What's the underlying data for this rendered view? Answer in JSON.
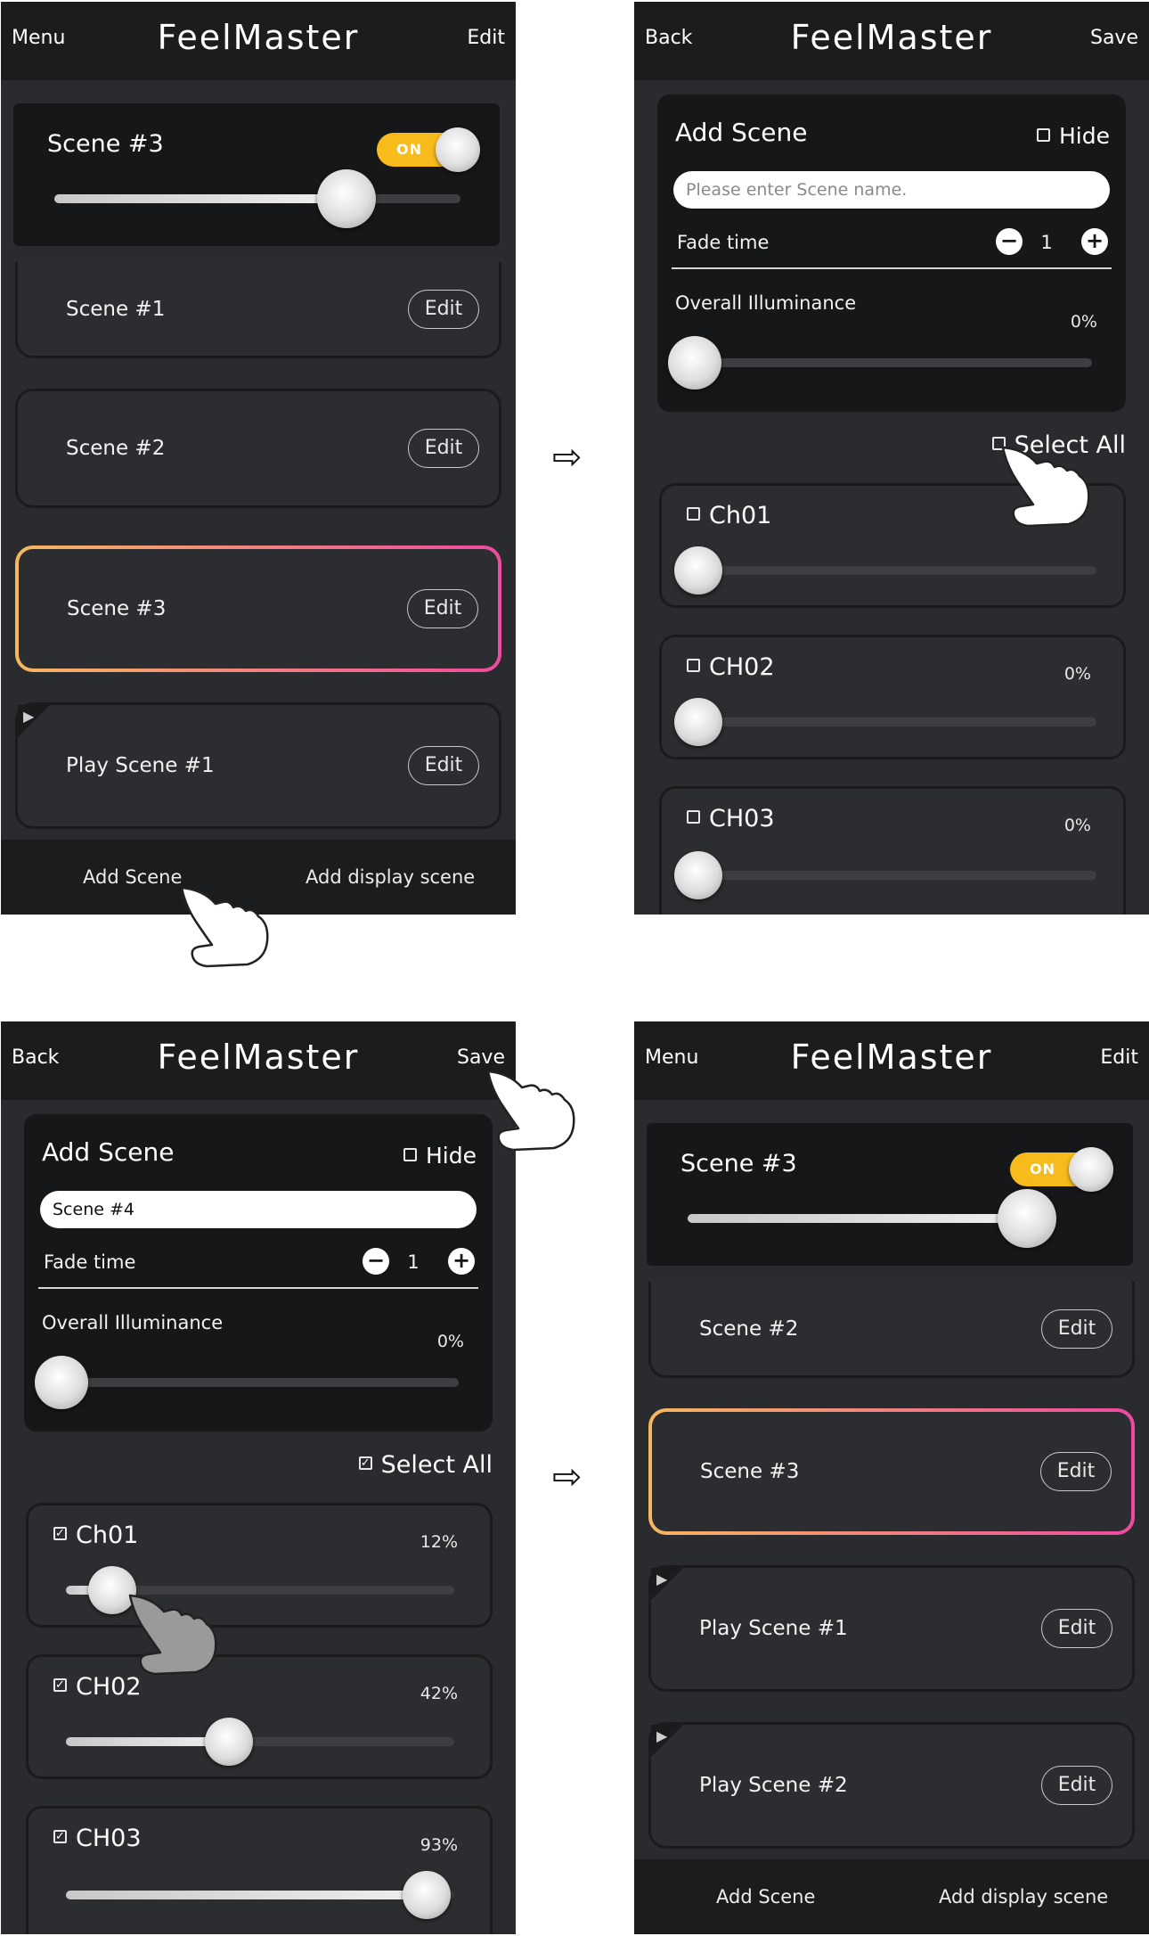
{
  "logo": "FeelMaster",
  "arrow_glyph": "⇨",
  "checkmark": "✓",
  "icons": [
    "hand-pointer-icon",
    "play-triangle-icon",
    "minus-icon",
    "plus-icon",
    "checkbox-icon"
  ],
  "colors": {
    "toggle_on": "#f7bb1b",
    "selected_gradient_start": "#f6b85f",
    "selected_gradient_end": "#ee4aa0",
    "screen_bg": "#2a2b2e",
    "bar_bg": "#1b1c1e"
  },
  "p1": {
    "menu": "Menu",
    "edit": "Edit",
    "active_scene": {
      "title": "Scene #3",
      "toggle": "ON",
      "level": 0.72
    },
    "scenes": [
      {
        "name": "Scene #1",
        "edit": "Edit"
      },
      {
        "name": "Scene #2",
        "edit": "Edit"
      },
      {
        "name": "Scene #3",
        "edit": "Edit"
      },
      {
        "name": "Play  Scene #1",
        "edit": "Edit",
        "play": "▶"
      }
    ],
    "bottom": {
      "add_scene": "Add Scene",
      "add_display": "Add display scene"
    }
  },
  "p2": {
    "back": "Back",
    "save": "Save",
    "add_scene": {
      "title": "Add Scene",
      "hide": "Hide",
      "name_placeholder": "Please enter Scene name.",
      "fade_label": "Fade time",
      "minus": "−",
      "plus": "+",
      "fade_value": "1",
      "overall_label": "Overall Illuminance",
      "overall_pct": "0%"
    },
    "select_all": "Select All",
    "channels": [
      {
        "name": "Ch01",
        "pct": "",
        "level": 0.0,
        "checked": false
      },
      {
        "name": "CH02",
        "pct": "0%",
        "level": 0.0,
        "checked": false
      },
      {
        "name": "CH03",
        "pct": "0%",
        "level": 0.0,
        "checked": false
      }
    ]
  },
  "p3": {
    "back": "Back",
    "save": "Save",
    "add_scene": {
      "title": "Add Scene",
      "hide": "Hide",
      "name_value": "Scene #4",
      "fade_label": "Fade time",
      "minus": "−",
      "plus": "+",
      "fade_value": "1",
      "overall_label": "Overall Illuminance",
      "overall_pct": "0%"
    },
    "select_all": "Select All",
    "channels": [
      {
        "name": "Ch01",
        "pct": "12%",
        "level": 0.12,
        "checked": true
      },
      {
        "name": "CH02",
        "pct": "42%",
        "level": 0.42,
        "checked": true
      },
      {
        "name": "CH03",
        "pct": "93%",
        "level": 0.93,
        "checked": true
      }
    ]
  },
  "p4": {
    "menu": "Menu",
    "edit": "Edit",
    "active_scene": {
      "title": "Scene #3",
      "toggle": "ON",
      "level": 0.93
    },
    "scenes": [
      {
        "name": "Scene #2",
        "edit": "Edit"
      },
      {
        "name": "Scene #3",
        "edit": "Edit"
      },
      {
        "name": "Play  Scene #1",
        "edit": "Edit",
        "play": "▶"
      },
      {
        "name": "Play  Scene #2",
        "edit": "Edit",
        "play": "▶"
      }
    ],
    "bottom": {
      "add_scene": "Add Scene",
      "add_display": "Add display scene"
    }
  }
}
